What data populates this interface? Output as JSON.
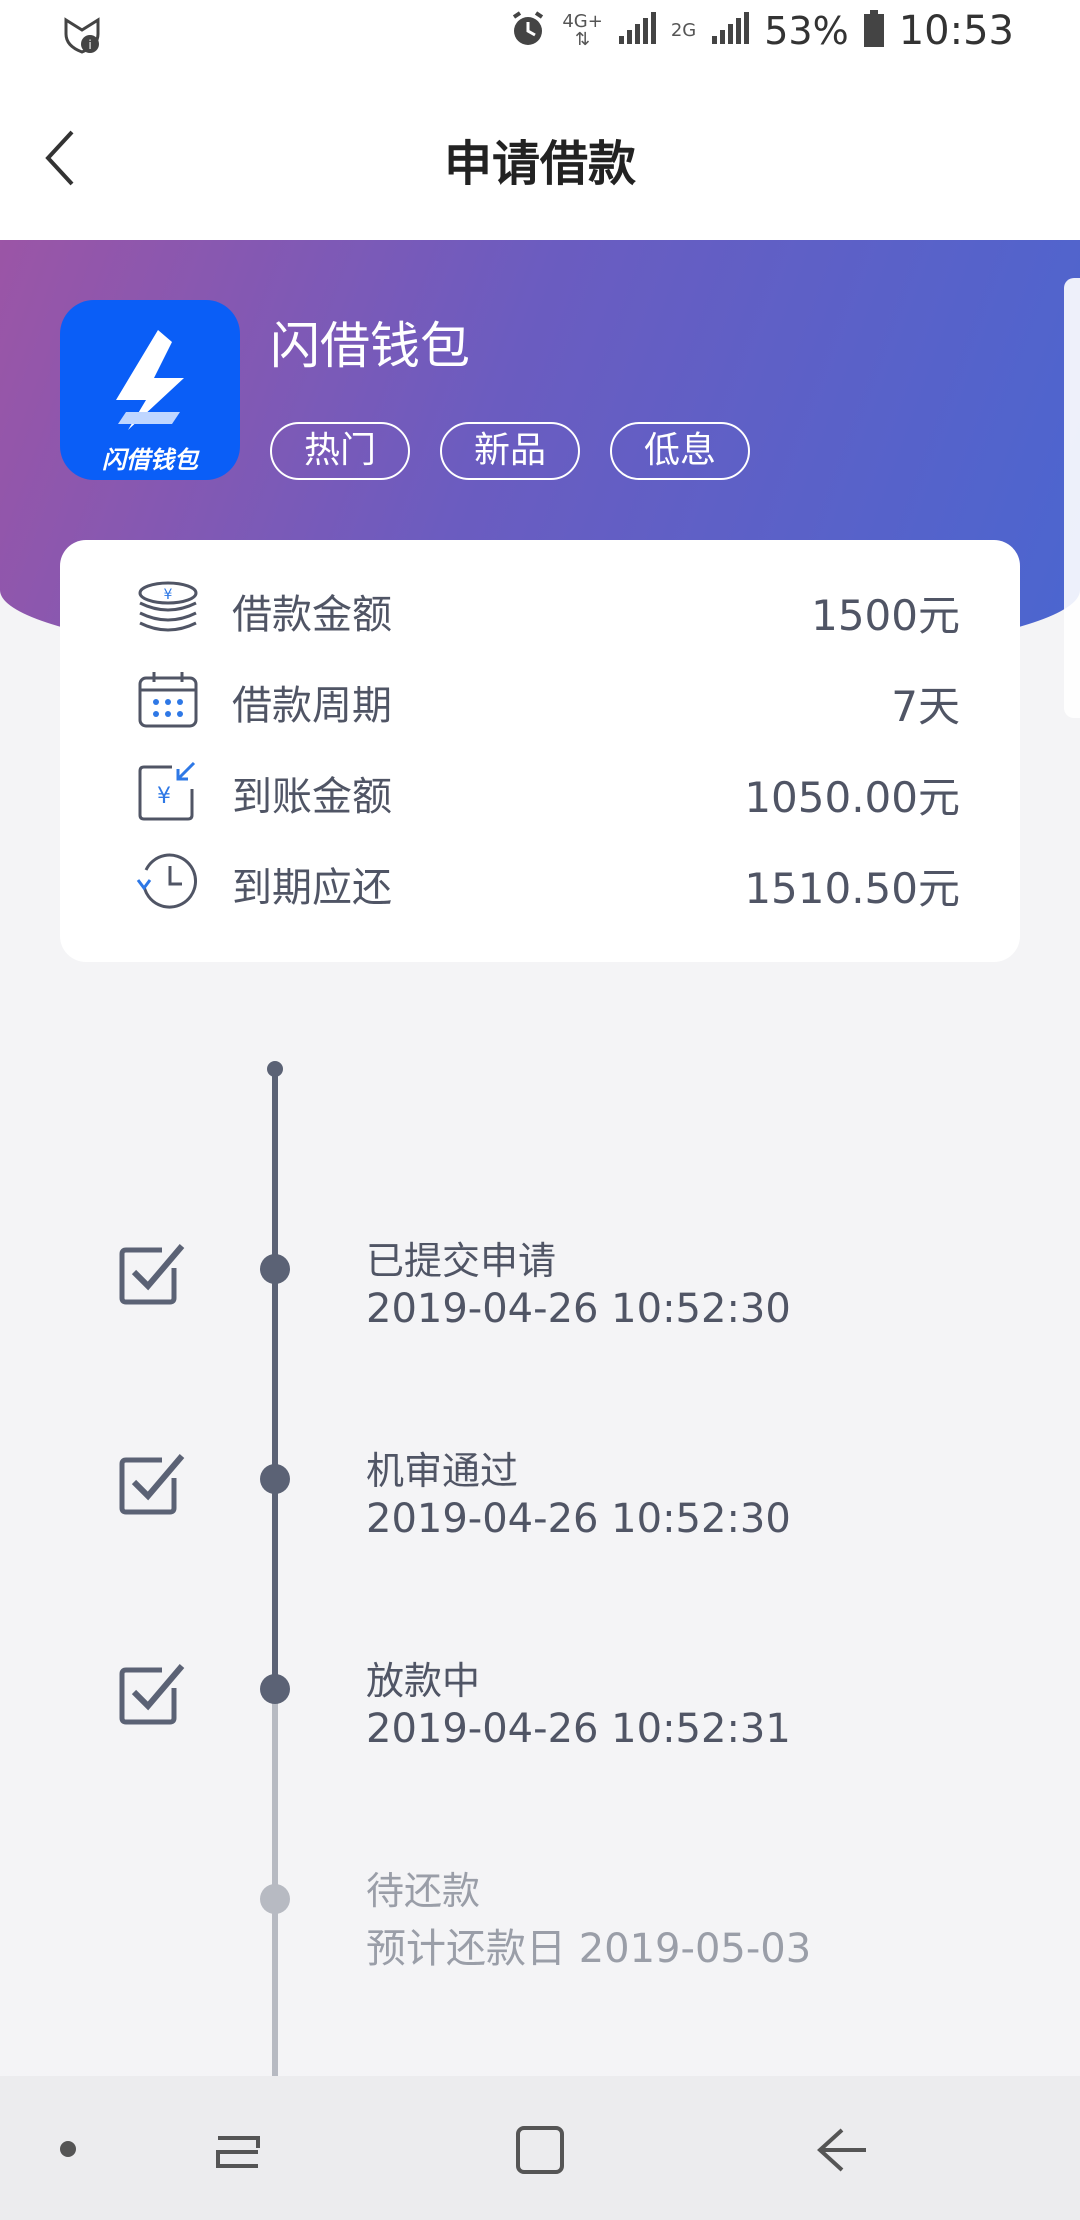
{
  "status_bar": {
    "network_top": "4G+",
    "network_second": "2G",
    "battery": "53%",
    "time": "10:53"
  },
  "header": {
    "title": "申请借款"
  },
  "product": {
    "logo_text": "闪借钱包",
    "name": "闪借钱包",
    "tags": [
      "热门",
      "新品",
      "低息"
    ],
    "logo_color": "#0a5ef7"
  },
  "loan_info": [
    {
      "icon": "coins-icon",
      "label": "借款金额",
      "value": "1500元"
    },
    {
      "icon": "calendar-icon",
      "label": "借款周期",
      "value": "7天"
    },
    {
      "icon": "money-received-icon",
      "label": "到账金额",
      "value": "1050.00元"
    },
    {
      "icon": "due-clock-icon",
      "label": "到期应还",
      "value": "1510.50元"
    }
  ],
  "timeline": [
    {
      "title": "已提交申请",
      "time": "2019-04-26 10:52:30",
      "done": true
    },
    {
      "title": "机审通过",
      "time": "2019-04-26 10:52:30",
      "done": true
    },
    {
      "title": "放款中",
      "time": "2019-04-26 10:52:31",
      "done": true
    },
    {
      "title": "待还款",
      "time": "预计还款日 2019-05-03",
      "done": false
    }
  ],
  "colors": {
    "accent_dark": "#5b6275",
    "accent_light": "#b7bac2",
    "hero_start": "#9b55a6",
    "hero_end": "#4a66d0"
  }
}
